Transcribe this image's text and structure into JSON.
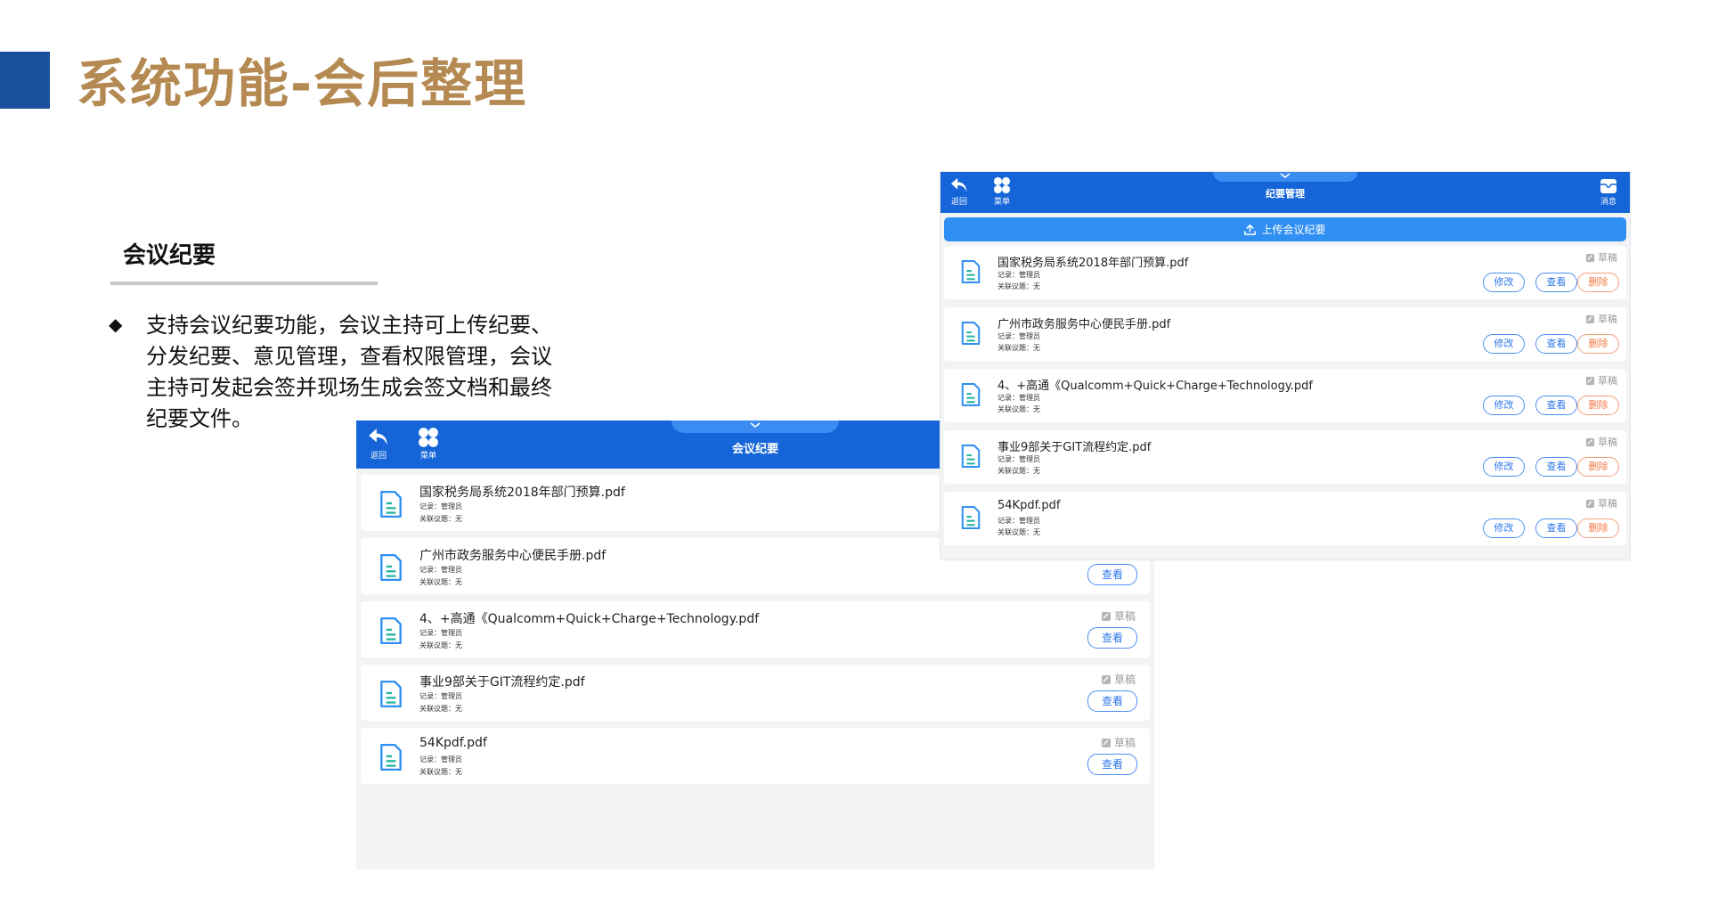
{
  "slide": {
    "title": "系统功能-会后整理",
    "section_title": "会议纪要",
    "bullet": "◆",
    "description": "支持会议纪要功能，会议主持可上传纪要、分发纪要、意见管理，查看权限管理，会议主持可发起会签并现场生成会签文档和最终纪要文件。"
  },
  "colors": {
    "accent": "#1565d8",
    "title_gold": "#b58a52",
    "delete": "#f07a45"
  },
  "front_screen": {
    "back_label": "返回",
    "menu_label": "菜单",
    "title": "会议纪要",
    "view_label": "查看",
    "draft_label": "草稿",
    "files": [
      {
        "name": "国家税务局系统2018年部门预算.pdf",
        "recorder": "记录：管理员",
        "topic": "关联议题：无"
      },
      {
        "name": "广州市政务服务中心便民手册.pdf",
        "recorder": "记录：管理员",
        "topic": "关联议题：无"
      },
      {
        "name": "4、+高通《Qualcomm+Quick+Charge+Technology.pdf",
        "recorder": "记录：管理员",
        "topic": "关联议题：无"
      },
      {
        "name": "事业9部关于GIT流程约定.pdf",
        "recorder": "记录：管理员",
        "topic": "关联议题：无"
      },
      {
        "name": "54Kpdf.pdf",
        "recorder": "记录：管理员",
        "topic": "关联议题：无"
      }
    ]
  },
  "back_screen": {
    "back_label": "返回",
    "menu_label": "菜单",
    "message_label": "消息",
    "title": "纪要管理",
    "upload_label": "上传会议纪要",
    "edit_label": "修改",
    "view_label": "查看",
    "delete_label": "删除",
    "draft_label": "草稿",
    "files": [
      {
        "name": "国家税务局系统2018年部门预算.pdf",
        "recorder": "记录：管理员",
        "topic": "关联议题：无"
      },
      {
        "name": "广州市政务服务中心便民手册.pdf",
        "recorder": "记录：管理员",
        "topic": "关联议题：无"
      },
      {
        "name": "4、+高通《Qualcomm+Quick+Charge+Technology.pdf",
        "recorder": "记录：管理员",
        "topic": "关联议题：无"
      },
      {
        "name": "事业9部关于GIT流程约定.pdf",
        "recorder": "记录：管理员",
        "topic": "关联议题：无"
      },
      {
        "name": "54Kpdf.pdf",
        "recorder": "记录：管理员",
        "topic": "关联议题：无"
      }
    ]
  }
}
